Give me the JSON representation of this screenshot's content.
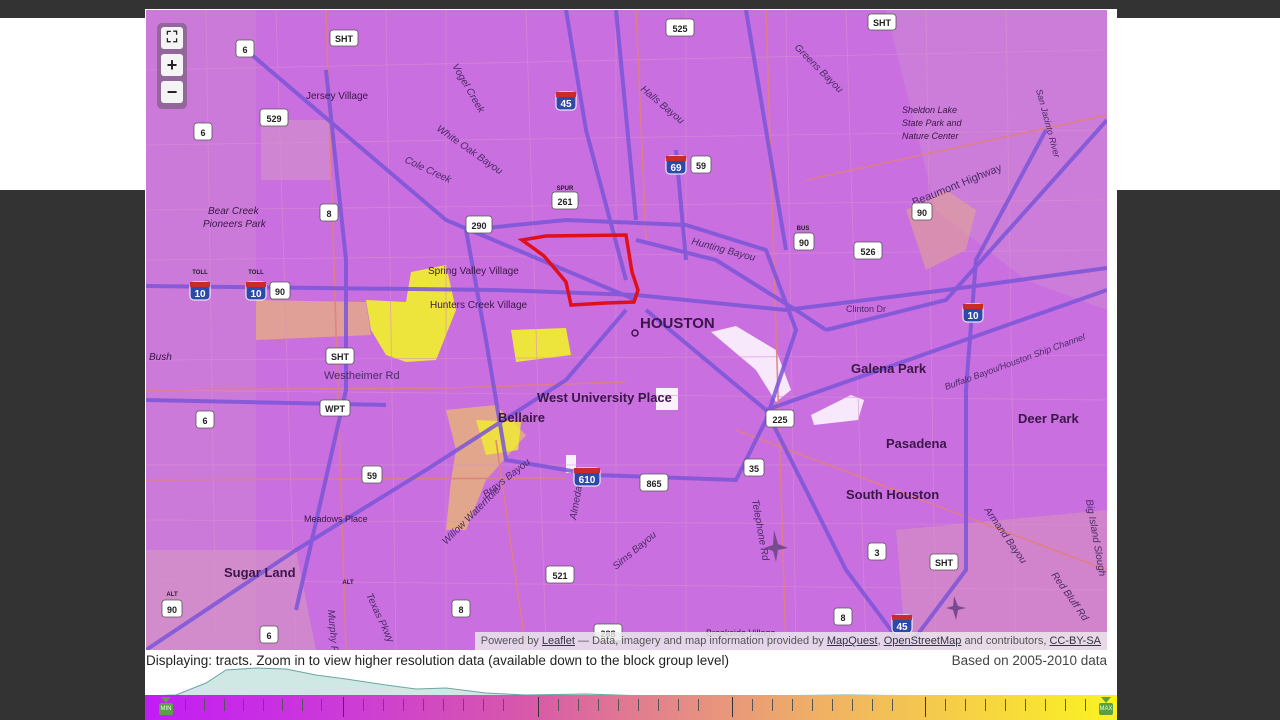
{
  "map": {
    "zoom_controls": {
      "fullscreen": "⛶",
      "zoom_in": "+",
      "zoom_out": "−"
    },
    "colors": {
      "base": "#c96fe0",
      "highway": "#7b56d8",
      "arterial": "#e0807f",
      "selected_outline": "#e0101a",
      "highlight_yellow": "#f1f22a",
      "highlight_tan": "#e9b477",
      "water_white": "#ffffff"
    },
    "place_labels": {
      "houston": "HOUSTON",
      "galena_park": "Galena Park",
      "west_university_place": "West University Place",
      "bellaire": "Bellaire",
      "pasadena": "Pasadena",
      "deer_park": "Deer Park",
      "south_houston": "South Houston",
      "sugar_land": "Sugar Land",
      "jersey_village": "Jersey Village",
      "spring_valley_village": "Spring Valley Village",
      "hunters_creek_village": "Hunters Creek Village",
      "meadows_place": "Meadows Place",
      "bear_creek": "Bear Creek",
      "pioneers_park": "Pioneers Park",
      "sheldon_lake_1": "Sheldon Lake",
      "sheldon_lake_2": "State Park and",
      "sheldon_lake_3": "Nature Center",
      "bush": "Bush",
      "brookside_village": "Brookside Village"
    },
    "road_labels": {
      "westheimer": "Westheimer Rd",
      "beaumont_highway": "Beaumont Highway",
      "white_oak_bayou": "White Oak Bayou",
      "cole_creek": "Cole Creek",
      "vogel_creek": "Vogel Creek",
      "halls_bayou": "Halls Bayou",
      "greens_bayou": "Greens Bayou",
      "hunting_bayou": "Hunting Bayou",
      "brays_bayou": "Brays Bayou",
      "sims_bayou": "Sims Bayou",
      "willow_waterhole": "Willow Waterhole",
      "telephone_rd": "Telephone Rd",
      "almeda_rd": "Almeda Rd",
      "texas_pkwy": "Texas Pkwy",
      "murphy_rd": "Murphy Rd",
      "armand_bayou": "Armand Bayou",
      "big_island_slough": "Big Island Slough",
      "red_bluff_rd": "Red Bluff Rd",
      "buffalo_bayou": "Buffalo Bayou/Houston Ship Channel",
      "san_jacinto": "San Jacinto River",
      "clinton_dr": "Clinton Dr"
    },
    "shields": {
      "i10_w": "10",
      "i10_mid": "10",
      "i10_e": "10",
      "i45_n": "45",
      "i45_s": "45",
      "i69": "69",
      "i610": "610",
      "us290": "290",
      "us90_w": "90",
      "us90_e": "90",
      "us90_alt": "90",
      "us59_n": "59",
      "us59_s": "59",
      "sht_nw": "SHT",
      "sht_ne": "SHT",
      "sht_w": "SHT",
      "sht_se": "SHT",
      "spur261": "261",
      "spur_label": "SPUR",
      "s6_nw": "6",
      "s6_w": "6",
      "s6_sw1": "6",
      "s6_sw2": "6",
      "s8_w": "8",
      "s8_sw": "8",
      "s8_se": "8",
      "s529": "529",
      "s525": "525",
      "s526": "526",
      "s225": "225",
      "s35": "35",
      "s3": "3",
      "s865": "865",
      "s521": "521",
      "s288": "288",
      "wpt": "WPT",
      "toll": "TOLL",
      "bus": "BUS",
      "alt": "ALT"
    },
    "attribution": {
      "prefix": "Powered by",
      "leaflet": "Leaflet",
      "mid": "— Data, imagery and map information provided by",
      "mapquest": "MapQuest",
      "sep": ",",
      "osm": "OpenStreetMap",
      "and": "and contributors,",
      "license": "CC-BY-SA"
    }
  },
  "status": {
    "displaying": "Displaying: tracts. Zoom in to view higher resolution data (available down to the block group level)",
    "based_on": "Based on 2005-2010 data"
  },
  "legend": {
    "min_label": "MIN",
    "max_label": "MAX",
    "gradient_start": "#c21cf5",
    "gradient_end": "#fbf320",
    "histogram_color": "#cfe8e4"
  }
}
